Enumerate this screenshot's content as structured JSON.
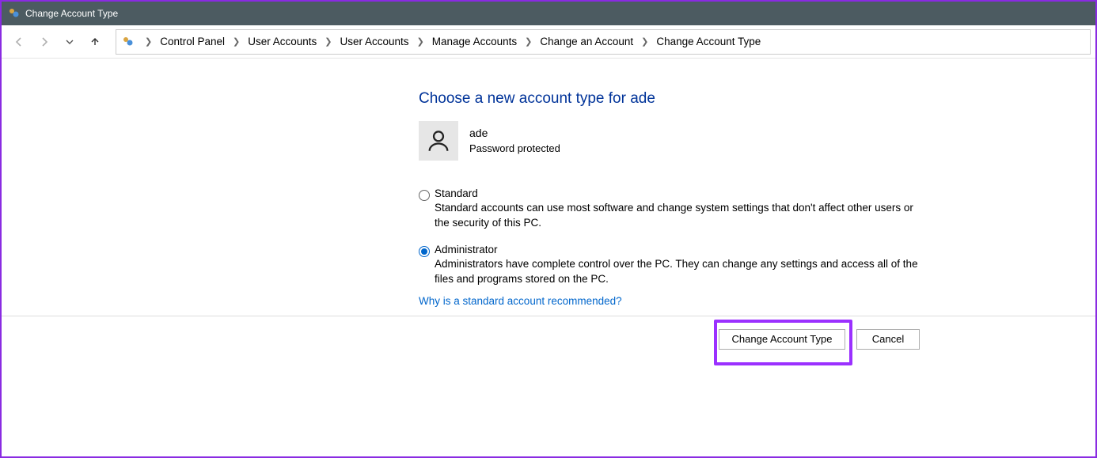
{
  "titlebar": {
    "title": "Change Account Type"
  },
  "nav": {
    "back_enabled": false,
    "forward_enabled": false
  },
  "breadcrumb": {
    "items": [
      "Control Panel",
      "User Accounts",
      "User Accounts",
      "Manage Accounts",
      "Change an Account",
      "Change Account Type"
    ]
  },
  "page": {
    "heading": "Choose a new account type for ade",
    "user": {
      "name": "ade",
      "status": "Password protected"
    },
    "options": [
      {
        "label": "Standard",
        "description": "Standard accounts can use most software and change system settings that don't affect other users or the security of this PC.",
        "selected": false
      },
      {
        "label": "Administrator",
        "description": "Administrators have complete control over the PC. They can change any settings and access all of the files and programs stored on the PC.",
        "selected": true
      }
    ],
    "help_link": "Why is a standard account recommended?"
  },
  "buttons": {
    "primary": "Change Account Type",
    "cancel": "Cancel"
  }
}
